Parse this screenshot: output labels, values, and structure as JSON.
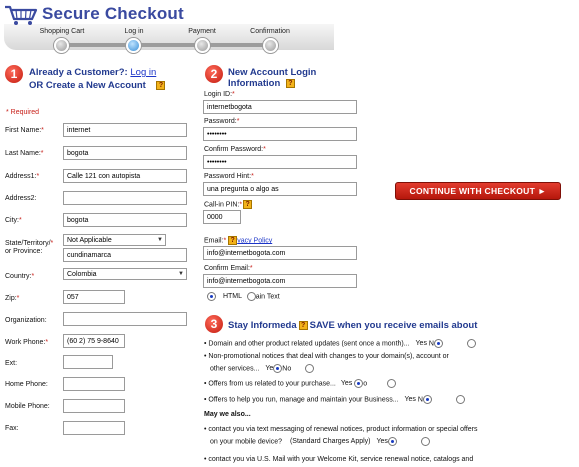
{
  "header": {
    "title": "Secure Checkout",
    "steps": [
      {
        "label": "Shopping Cart",
        "active": false
      },
      {
        "label": "Log in",
        "active": true
      },
      {
        "label": "Payment",
        "active": false
      },
      {
        "label": "Confirmation",
        "active": false
      }
    ]
  },
  "section1": {
    "number": "1",
    "title_line1": "Already a Customer?:",
    "login_link": "Log in",
    "title_line2": "OR Create a New Account",
    "required_note": "* Required",
    "fields": {
      "first_name": {
        "label": "First Name:",
        "value": "internet"
      },
      "last_name": {
        "label": "Last Name:",
        "value": "bogota"
      },
      "address1": {
        "label": "Address1:",
        "value": "Calle 121 con autopista"
      },
      "address2": {
        "label": "Address2:",
        "value": ""
      },
      "city": {
        "label": "City:",
        "value": "bogota"
      },
      "state_label_1": "State/Territory/",
      "state_label_2": "or Province:",
      "state_select": "Not Applicable",
      "state_value": "cundinamarca",
      "country": {
        "label": "Country:",
        "value": "Colombia"
      },
      "zip": {
        "label": "Zip:",
        "value": "057"
      },
      "organization": {
        "label": "Organization:",
        "value": ""
      },
      "work_phone": {
        "label": "Work Phone:",
        "value": "(60 2) 75 9-8640"
      },
      "ext": {
        "label": "Ext:",
        "value": ""
      },
      "home_phone": {
        "label": "Home Phone:",
        "value": ""
      },
      "mobile_phone": {
        "label": "Mobile Phone:",
        "value": ""
      },
      "fax": {
        "label": "Fax:",
        "value": ""
      }
    }
  },
  "section2": {
    "number": "2",
    "title_line1": "New Account Login",
    "title_line2": "Information",
    "login_id": {
      "label": "Login ID:",
      "value": "internetbogota"
    },
    "password": {
      "label": "Password:",
      "value": "••••••••"
    },
    "confirm_password": {
      "label": "Confirm Password:",
      "value": "••••••••"
    },
    "password_hint": {
      "label": "Password Hint:",
      "value": "una pregunta o algo as"
    },
    "call_in_pin": {
      "label": "Call-in PIN:",
      "value": "0000"
    },
    "email": {
      "label": "Email:",
      "privacy_link": "vacy Policy",
      "value": "info@internetbogota.com"
    },
    "confirm_email": {
      "label": "Confirm Email:",
      "value": "info@internetbogota.com"
    },
    "format_html": "HTML",
    "format_plain": "ain Text"
  },
  "continue_button": "CONTINUE WITH CHECKOUT ►",
  "section3": {
    "number": "3",
    "title_a": "Stay Informeda",
    "title_b": "SAVE when you receive emails about",
    "options": [
      {
        "text": "• Domain and other product related updates (sent once a month)...",
        "yes": "Yes",
        "no": "N"
      },
      {
        "text": "• Non-promotional notices that deal with changes to your domain(s), account or",
        "text2": "other services...",
        "yes": "Ye",
        "no": "No"
      },
      {
        "text": "• Offers from us related to your purchase...",
        "yes": "Yes",
        "no": "o"
      },
      {
        "text": "• Offers to help you run, manage and maintain your Business...",
        "yes": "Yes",
        "no": "N"
      }
    ],
    "may_we_also": "May we also...",
    "text_msg_1": "• contact you via text messaging of renewal notices, product information or special offers",
    "text_msg_2": "on your mobile device?",
    "text_msg_3": "(Standard Charges Apply)",
    "text_msg_yes": "Yes",
    "mail_line": "• contact you via U.S. Mail with your Welcome Kit, service renewal notice, catalogs and"
  },
  "colors": {
    "brand_blue": "#3a4aa0",
    "heading_blue": "#223a8f",
    "required_red": "#c8201a",
    "button_red": "#c8231a"
  }
}
